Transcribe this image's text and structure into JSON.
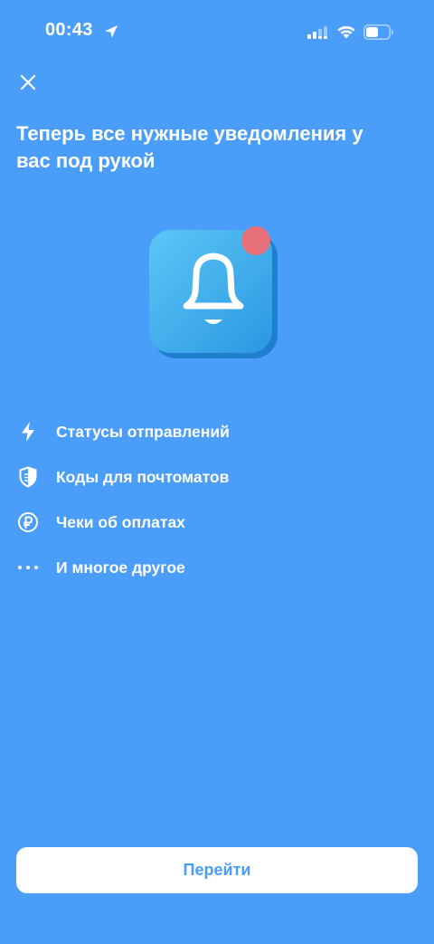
{
  "status_bar": {
    "time": "00:43",
    "icons": [
      "location-arrow-icon",
      "cellular-signal-icon",
      "wifi-icon",
      "battery-icon"
    ]
  },
  "header": {
    "close_icon": "close-icon"
  },
  "title": "Теперь все нужные уведомления у вас под рукой",
  "hero": {
    "icon": "notification-bell-icon",
    "badge_color": "#e8707a",
    "tile_color": "#3bb0ee"
  },
  "features": [
    {
      "icon": "lightning-icon",
      "label": "Статусы отправлений"
    },
    {
      "icon": "shield-icon",
      "label": "Коды для почтоматов"
    },
    {
      "icon": "ruble-icon",
      "label": "Чеки об оплатах"
    },
    {
      "icon": "ellipsis-icon",
      "label": "И многое другое"
    }
  ],
  "cta": {
    "label": "Перейти"
  },
  "colors": {
    "background": "#4a9ef9",
    "button_background": "#ffffff",
    "button_text": "#4a9ef9"
  }
}
